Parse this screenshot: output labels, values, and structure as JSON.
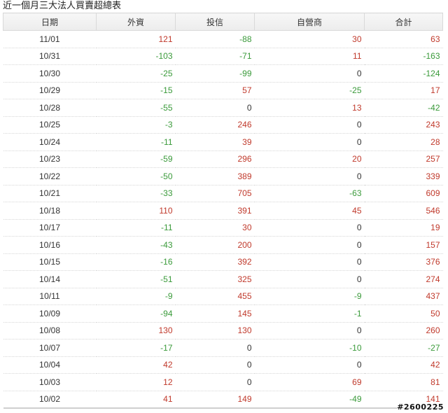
{
  "title": "近一個月三大法人買賣超總表",
  "headers": [
    "日期",
    "外資",
    "投信",
    "自營商",
    "合計"
  ],
  "rows": [
    {
      "date": "11/01",
      "foreign": "121",
      "trust": "-88",
      "dealer": "30",
      "total": "63"
    },
    {
      "date": "10/31",
      "foreign": "-103",
      "trust": "-71",
      "dealer": "11",
      "total": "-163"
    },
    {
      "date": "10/30",
      "foreign": "-25",
      "trust": "-99",
      "dealer": "0",
      "total": "-124"
    },
    {
      "date": "10/29",
      "foreign": "-15",
      "trust": "57",
      "dealer": "-25",
      "total": "17"
    },
    {
      "date": "10/28",
      "foreign": "-55",
      "trust": "0",
      "dealer": "13",
      "total": "-42"
    },
    {
      "date": "10/25",
      "foreign": "-3",
      "trust": "246",
      "dealer": "0",
      "total": "243"
    },
    {
      "date": "10/24",
      "foreign": "-11",
      "trust": "39",
      "dealer": "0",
      "total": "28"
    },
    {
      "date": "10/23",
      "foreign": "-59",
      "trust": "296",
      "dealer": "20",
      "total": "257"
    },
    {
      "date": "10/22",
      "foreign": "-50",
      "trust": "389",
      "dealer": "0",
      "total": "339"
    },
    {
      "date": "10/21",
      "foreign": "-33",
      "trust": "705",
      "dealer": "-63",
      "total": "609"
    },
    {
      "date": "10/18",
      "foreign": "110",
      "trust": "391",
      "dealer": "45",
      "total": "546"
    },
    {
      "date": "10/17",
      "foreign": "-11",
      "trust": "30",
      "dealer": "0",
      "total": "19"
    },
    {
      "date": "10/16",
      "foreign": "-43",
      "trust": "200",
      "dealer": "0",
      "total": "157"
    },
    {
      "date": "10/15",
      "foreign": "-16",
      "trust": "392",
      "dealer": "0",
      "total": "376"
    },
    {
      "date": "10/14",
      "foreign": "-51",
      "trust": "325",
      "dealer": "0",
      "total": "274"
    },
    {
      "date": "10/11",
      "foreign": "-9",
      "trust": "455",
      "dealer": "-9",
      "total": "437"
    },
    {
      "date": "10/09",
      "foreign": "-94",
      "trust": "145",
      "dealer": "-1",
      "total": "50"
    },
    {
      "date": "10/08",
      "foreign": "130",
      "trust": "130",
      "dealer": "0",
      "total": "260"
    },
    {
      "date": "10/07",
      "foreign": "-17",
      "trust": "0",
      "dealer": "-10",
      "total": "-27"
    },
    {
      "date": "10/04",
      "foreign": "42",
      "trust": "0",
      "dealer": "0",
      "total": "42"
    },
    {
      "date": "10/03",
      "foreign": "12",
      "trust": "0",
      "dealer": "69",
      "total": "81"
    },
    {
      "date": "10/02",
      "foreign": "41",
      "trust": "149",
      "dealer": "-49",
      "total": "141"
    }
  ],
  "colors": {
    "positive": "#c0392b",
    "negative": "#3a9a3a",
    "zero": "#333333"
  },
  "watermark": "#2600225"
}
